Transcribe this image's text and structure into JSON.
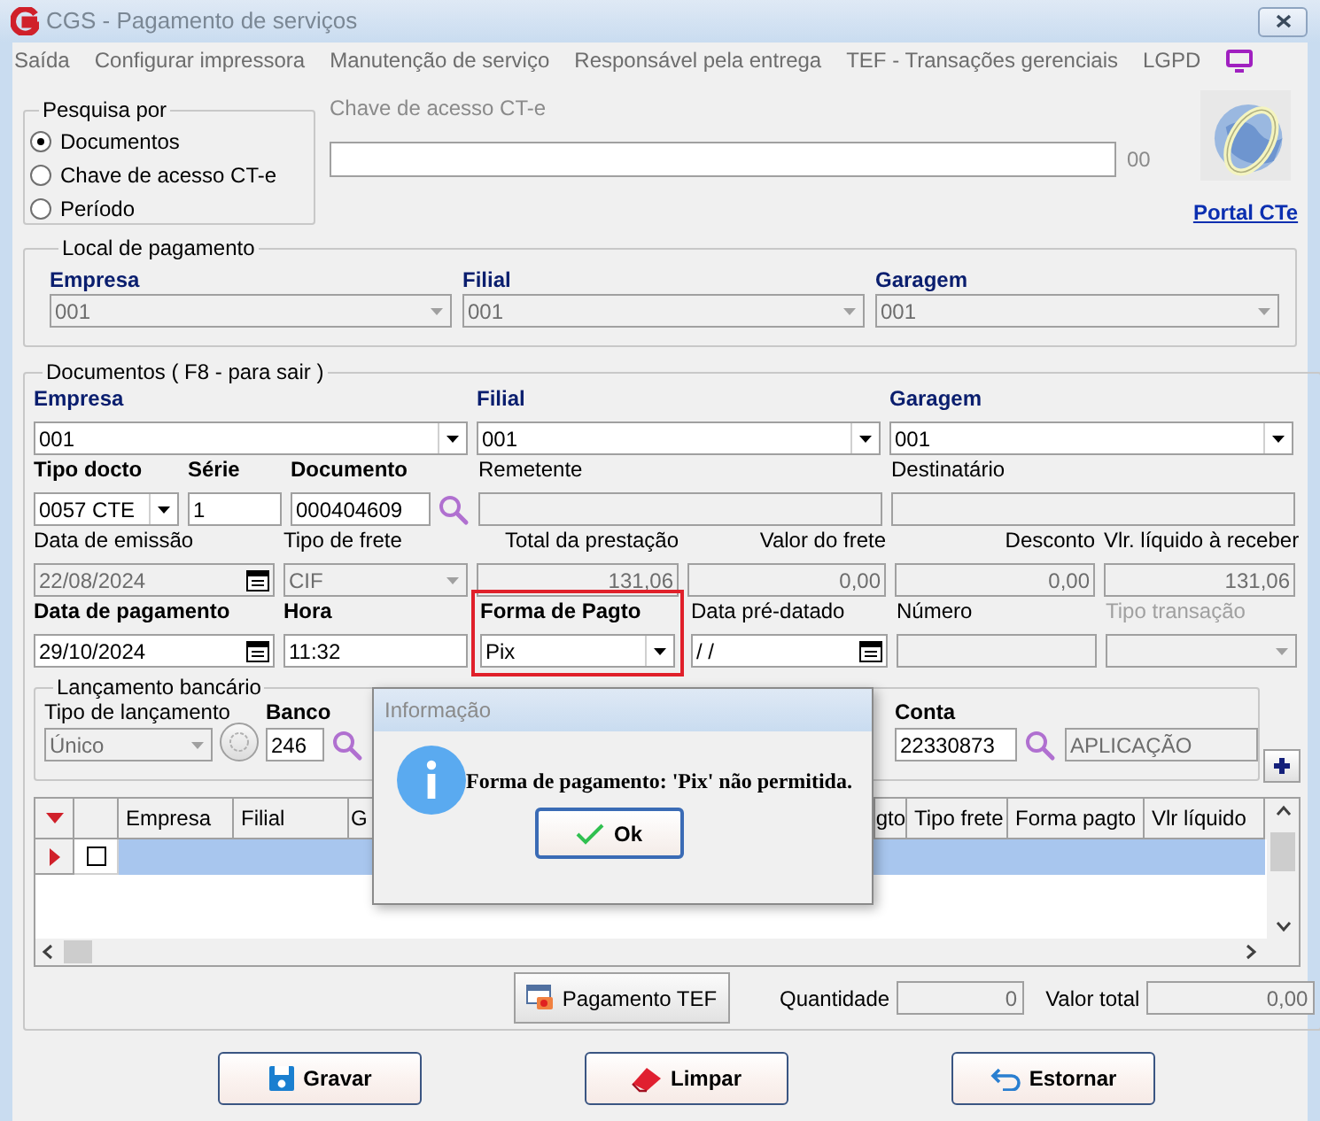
{
  "window": {
    "title": "CGS - Pagamento de serviços"
  },
  "menu": [
    {
      "label": "Saída"
    },
    {
      "label": "Configurar impressora"
    },
    {
      "label": "Manutenção de serviço"
    },
    {
      "label": "Responsável pela entrega"
    },
    {
      "label": "TEF - Transações gerenciais"
    },
    {
      "label": "LGPD"
    }
  ],
  "search_by": {
    "title": "Pesquisa por",
    "options": [
      {
        "label": "Documentos",
        "selected": true
      },
      {
        "label": "Chave de acesso CT-e",
        "selected": false
      },
      {
        "label": "Período",
        "selected": false
      }
    ]
  },
  "access_key": {
    "label": "Chave de acesso CT-e",
    "check_digit": "00"
  },
  "portal_link": "Portal CTe",
  "payment_location": {
    "title": "Local de pagamento",
    "fields": [
      {
        "label": "Empresa",
        "value": "001"
      },
      {
        "label": "Filial",
        "value": "001"
      },
      {
        "label": "Garagem",
        "value": "001"
      }
    ]
  },
  "documents": {
    "title": "Documentos ( F8 - para sair )",
    "fields": [
      {
        "label": "Empresa",
        "value": "001",
        "kind": "combo",
        "bold": true,
        "disabled": false,
        "dimmed": false,
        "highlighted": false
      },
      {
        "label": "Filial",
        "value": "001",
        "kind": "combo",
        "bold": true,
        "disabled": false,
        "dimmed": false,
        "highlighted": false
      },
      {
        "label": "Garagem",
        "value": "001",
        "kind": "combo",
        "bold": true,
        "disabled": false,
        "dimmed": false,
        "highlighted": false
      },
      {
        "label": "Tipo docto",
        "value": "0057 CTE",
        "kind": "combo",
        "bold": true,
        "disabled": false,
        "dimmed": false,
        "highlighted": false
      },
      {
        "label": "Série",
        "value": "1",
        "kind": "text",
        "bold": true,
        "disabled": false,
        "dimmed": false,
        "highlighted": false
      },
      {
        "label": "Documento",
        "value": "000404609",
        "kind": "lookup",
        "bold": true,
        "disabled": false,
        "dimmed": false,
        "highlighted": false
      },
      {
        "label": "Remetente",
        "kind": "text",
        "bold": false,
        "disabled": true,
        "dimmed": false,
        "highlighted": false
      },
      {
        "label": "Destinatário",
        "kind": "text",
        "bold": false,
        "disabled": true,
        "dimmed": false,
        "highlighted": false
      },
      {
        "label": "Data de emissão",
        "value": "22/08/2024",
        "kind": "date",
        "bold": false,
        "disabled": true,
        "dimmed": false,
        "highlighted": false
      },
      {
        "label": "Tipo de frete",
        "value": "CIF",
        "kind": "combo",
        "bold": false,
        "disabled": true,
        "dimmed": false,
        "highlighted": false
      },
      {
        "label": "Total da prestação",
        "value": "131,06",
        "kind": "number",
        "bold": false,
        "disabled": true,
        "dimmed": false,
        "highlighted": false
      },
      {
        "label": "Valor do frete",
        "value": "0,00",
        "kind": "number",
        "bold": false,
        "disabled": true,
        "dimmed": false,
        "highlighted": false
      },
      {
        "label": "Desconto",
        "value": "0,00",
        "kind": "number",
        "bold": false,
        "disabled": true,
        "dimmed": false,
        "highlighted": false
      },
      {
        "label": "Vlr. líquido à receber",
        "value": "131,06",
        "kind": "number",
        "bold": false,
        "disabled": true,
        "dimmed": false,
        "highlighted": false
      },
      {
        "label": "Data de pagamento",
        "value": "29/10/2024",
        "kind": "date",
        "bold": true,
        "disabled": false,
        "dimmed": false,
        "highlighted": false
      },
      {
        "label": "Hora",
        "value": "11:32",
        "kind": "text",
        "bold": true,
        "disabled": false,
        "dimmed": false,
        "highlighted": false
      },
      {
        "label": "Forma de Pagto",
        "value": "Pix",
        "kind": "combo",
        "bold": true,
        "disabled": false,
        "dimmed": false,
        "highlighted": true
      },
      {
        "label": "Data pré-datado",
        "value": " / /",
        "kind": "date",
        "bold": false,
        "disabled": false,
        "dimmed": false,
        "highlighted": false
      },
      {
        "label": "Número",
        "kind": "text",
        "bold": false,
        "disabled": true,
        "dimmed": false,
        "highlighted": false
      },
      {
        "label": "Tipo transação",
        "kind": "combo",
        "bold": false,
        "disabled": true,
        "dimmed": true,
        "highlighted": false
      }
    ]
  },
  "bank_entry": {
    "title": "Lançamento bancário",
    "fields": [
      {
        "label": "Tipo de lançamento",
        "value": "Único",
        "kind": "combo",
        "bold": false,
        "disabled": true
      },
      {
        "label": "Banco",
        "value": "246",
        "kind": "lookup",
        "bold": true,
        "disabled": false
      },
      {
        "label": "Conta",
        "value": "22330873",
        "kind": "lookup",
        "bold": true,
        "disabled": false
      },
      {
        "value": "APLICAÇÃO",
        "kind": "text",
        "disabled": true
      }
    ]
  },
  "grid": {
    "columns": [
      "Empresa",
      "Filial",
      "G",
      "gto",
      "Tipo frete",
      "Forma pagto",
      "Vlr líquido"
    ],
    "rows": [
      {
        "selected": true,
        "checked": false
      }
    ]
  },
  "tef_button": "Pagamento TEF",
  "totals": [
    {
      "label": "Quantidade",
      "value": "0"
    },
    {
      "label": "Valor total",
      "value": "0,00"
    }
  ],
  "actions": [
    {
      "label": "Gravar",
      "kind": "save"
    },
    {
      "label": "Limpar",
      "kind": "clear"
    },
    {
      "label": "Estornar",
      "kind": "reverse"
    }
  ],
  "dialog": {
    "title": "Informação",
    "message": "Forma de pagamento: 'Pix' não permitida.",
    "button": "Ok"
  }
}
